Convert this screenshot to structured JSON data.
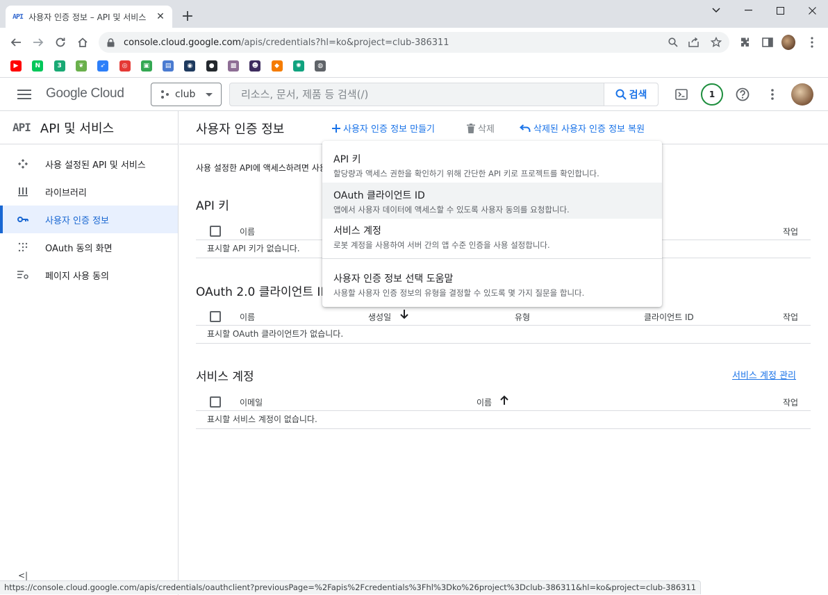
{
  "browser": {
    "tab_favicon": "API",
    "tab_title": "사용자 인증 정보 – API 및 서비스",
    "tab_close": "✕",
    "new_tab": "+",
    "url_host": "console.cloud.google.com",
    "url_path": "/apis/credentials?hl=ko&project=club-386311",
    "status_url": "https://console.cloud.google.com/apis/credentials/oauthclient?previousPage=%2Fapis%2Fcredentials%3Fhl%3Dko%26project%3Dclub-386311&hl=ko&project=club-386311"
  },
  "bookmarks": [
    {
      "icon": "youtube-icon",
      "color": "#ff0000",
      "glyph": "▶"
    },
    {
      "icon": "naver-icon",
      "color": "#03c75a",
      "glyph": "N"
    },
    {
      "icon": "green-app-icon",
      "color": "#19a974",
      "glyph": "3"
    },
    {
      "icon": "leaf-icon",
      "color": "#6ab04c",
      "glyph": "❦"
    },
    {
      "icon": "bird-icon",
      "color": "#2d7ff9",
      "glyph": "➶"
    },
    {
      "icon": "ring-icon",
      "color": "#e53935",
      "glyph": "◎"
    },
    {
      "icon": "classroom-icon",
      "color": "#34a853",
      "glyph": "▣"
    },
    {
      "icon": "blue-box-icon",
      "color": "#4a7bd1",
      "glyph": "▤"
    },
    {
      "icon": "owl-icon",
      "color": "#1e3a5f",
      "glyph": "◉"
    },
    {
      "icon": "github-icon",
      "color": "#24292e",
      "glyph": "●"
    },
    {
      "icon": "image-icon",
      "color": "#8e6e95",
      "glyph": "▩"
    },
    {
      "icon": "astronaut-icon",
      "color": "#3d2c5e",
      "glyph": "☻"
    },
    {
      "icon": "orange-cube-icon",
      "color": "#f57c00",
      "glyph": "◆"
    },
    {
      "icon": "chatgpt-icon",
      "color": "#10a37f",
      "glyph": "✺"
    },
    {
      "icon": "globe-icon",
      "color": "#5f6368",
      "glyph": "◍"
    }
  ],
  "header": {
    "logo_google": "Google",
    "logo_cloud": "Cloud",
    "project": "club",
    "search_placeholder": "리소스, 문서, 제품 등 검색(/)",
    "search_button": "검색",
    "notifications": "1"
  },
  "sidebar": {
    "badge": "API",
    "title": "API 및 서비스",
    "items": [
      {
        "label": "사용 설정된 API 및 서비스",
        "icon": "diamond-icon"
      },
      {
        "label": "라이브러리",
        "icon": "library-icon"
      },
      {
        "label": "사용자 인증 정보",
        "icon": "key-icon"
      },
      {
        "label": "OAuth 동의 화면",
        "icon": "dots-grid-icon"
      },
      {
        "label": "페이지 사용 동의",
        "icon": "settings-list-icon"
      }
    ],
    "collapse": "<|"
  },
  "main": {
    "title": "사용자 인증 정보",
    "actions": {
      "create": "사용자 인증 정보 만들기",
      "delete": "삭제",
      "restore": "삭제된 사용자 인증 정보 복원"
    },
    "intro": "사용 설정한 API에 액세스하려면 사용자 인증 정보를 만드세요.",
    "api_keys": {
      "title": "API 키",
      "headers": {
        "name": "이름",
        "actions": "작업"
      },
      "empty": "표시할 API 키가 없습니다."
    },
    "oauth": {
      "title": "OAuth 2.0 클라이언트 ID",
      "headers": {
        "name": "이름",
        "created": "생성일",
        "type": "유형",
        "client_id": "클라이언트 ID",
        "actions": "작업"
      },
      "empty": "표시할 OAuth 클라이언트가 없습니다."
    },
    "service_accounts": {
      "title": "서비스 계정",
      "manage_link": "서비스 계정 관리",
      "headers": {
        "email": "이메일",
        "name": "이름",
        "actions": "작업"
      },
      "empty": "표시할 서비스 계정이 없습니다."
    }
  },
  "menu": {
    "items": [
      {
        "title": "API 키",
        "desc": "할당량과 액세스 권한을 확인하기 위해 간단한 API 키로 프로젝트를 확인합니다."
      },
      {
        "title": "OAuth 클라이언트 ID",
        "desc": "앱에서 사용자 데이터에 액세스할 수 있도록 사용자 동의를 요청합니다."
      },
      {
        "title": "서비스 계정",
        "desc": "로봇 계정을 사용하여 서버 간의 앱 수준 인증을 사용 설정합니다."
      },
      {
        "title": "사용자 인증 정보 선택 도움말",
        "desc": "사용할 사용자 인증 정보의 유형을 결정할 수 있도록 몇 가지 질문을 합니다."
      }
    ]
  },
  "colors": {
    "accent": "#1a73e8",
    "active_bg": "#e8f0fe",
    "notif_ring": "#1e8e3e"
  }
}
